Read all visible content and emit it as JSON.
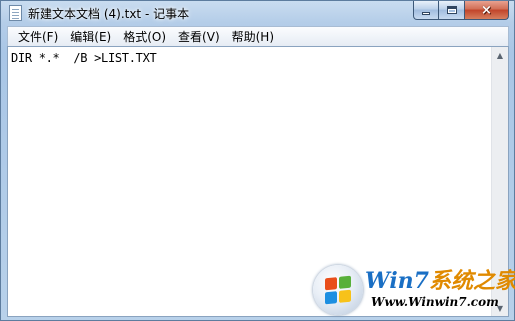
{
  "window": {
    "title": "新建文本文档 (4).txt - 记事本"
  },
  "caption_buttons": {
    "minimize": "minimize",
    "maximize": "maximize",
    "close": "×"
  },
  "menu": [
    {
      "label": "文件(F)"
    },
    {
      "label": "编辑(E)"
    },
    {
      "label": "格式(O)"
    },
    {
      "label": "查看(V)"
    },
    {
      "label": "帮助(H)"
    }
  ],
  "editor": {
    "content": "DIR *.*  /B >LIST.TXT"
  },
  "scrollbar": {
    "up_arrow": "▲",
    "down_arrow": "▼"
  },
  "watermark": {
    "brand_part1": "Win7",
    "brand_part2": "系统之家",
    "url": "Www.Winwin7.com",
    "logo_colors": [
      "#e94e1b",
      "#58b03a",
      "#1d8fe1",
      "#f7c21a"
    ]
  }
}
